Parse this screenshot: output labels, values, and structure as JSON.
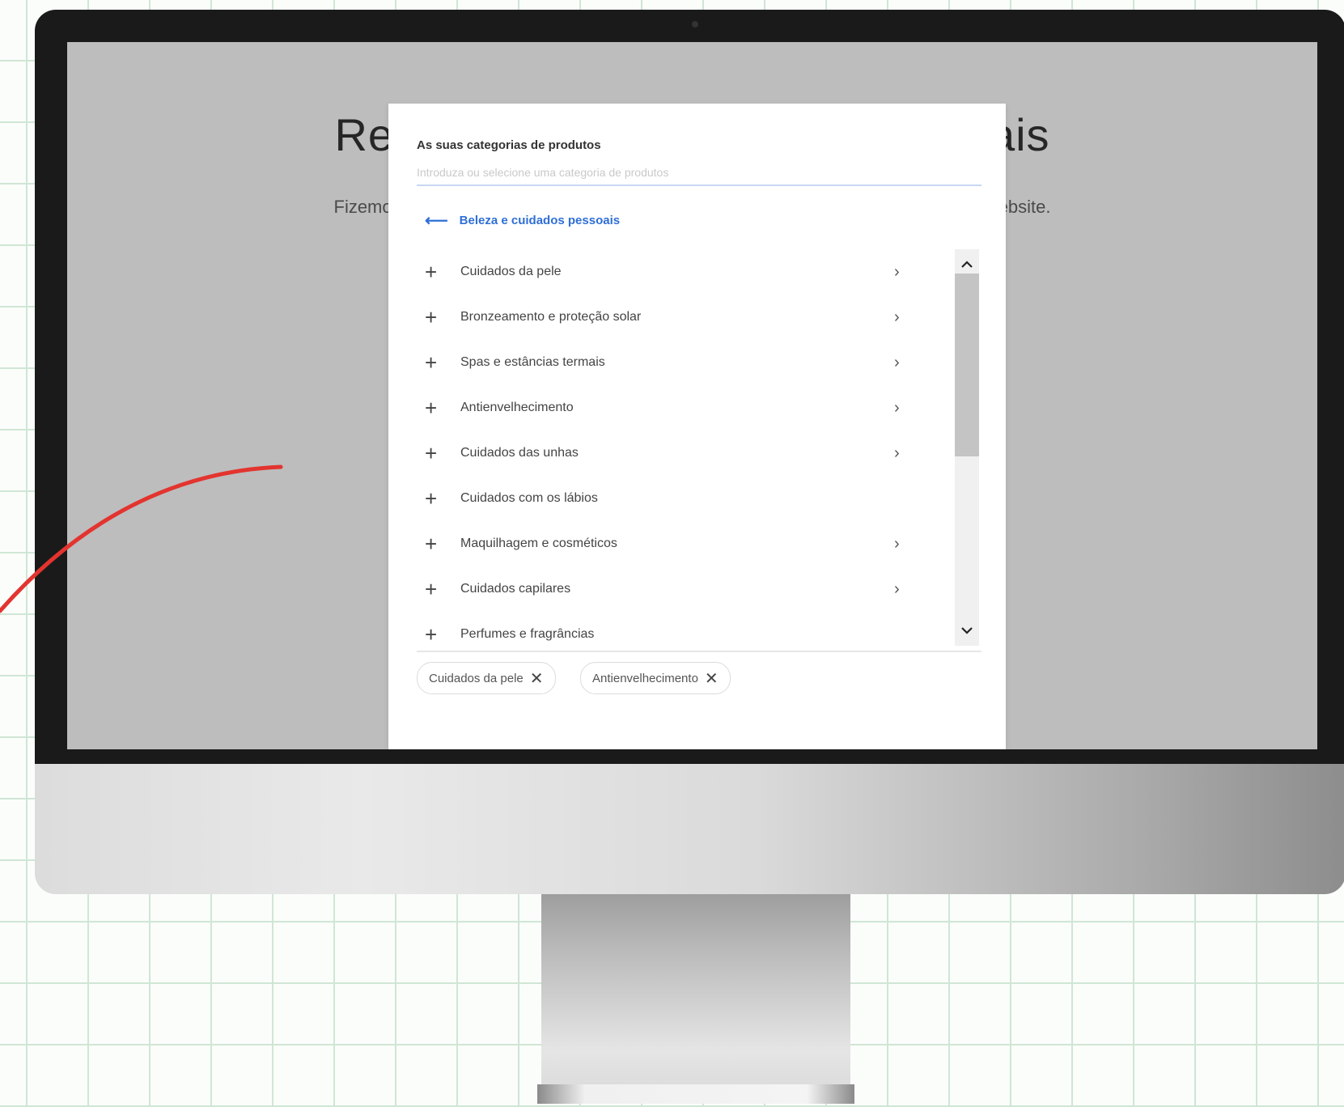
{
  "hero": {
    "title": "Revej                                    ariais",
    "text": "Fizemos correspond                                                                              ções do seu Website.\nNão hesite                                                                                  ximo passo."
  },
  "modal": {
    "title": "As suas categorias de produtos",
    "search_placeholder": "Introduza ou selecione uma categoria de produtos",
    "back_label": "Beleza e cuidados pessoais",
    "categories": [
      {
        "label": "Cuidados da pele",
        "has_children": true
      },
      {
        "label": "Bronzeamento e proteção solar",
        "has_children": true
      },
      {
        "label": "Spas e estâncias termais",
        "has_children": true
      },
      {
        "label": "Antienvelhecimento",
        "has_children": true
      },
      {
        "label": "Cuidados das unhas",
        "has_children": true
      },
      {
        "label": "Cuidados com os lábios",
        "has_children": false
      },
      {
        "label": "Maquilhagem e cosméticos",
        "has_children": true
      },
      {
        "label": "Cuidados capilares",
        "has_children": true
      },
      {
        "label": "Perfumes e fragrâncias",
        "has_children": false
      }
    ],
    "selected_chips": [
      "Cuidados da pele",
      "Antienvelhecimento"
    ]
  },
  "icons": {
    "back": "arrow-left-icon",
    "add": "plus-icon",
    "expand": "chevron-right-icon",
    "scroll_up": "chevron-up-icon",
    "scroll_down": "chevron-down-icon",
    "remove": "close-icon"
  },
  "colors": {
    "accent": "#2f6fd6",
    "annotation": "#e3342f",
    "grid": "#cfe6d4"
  }
}
